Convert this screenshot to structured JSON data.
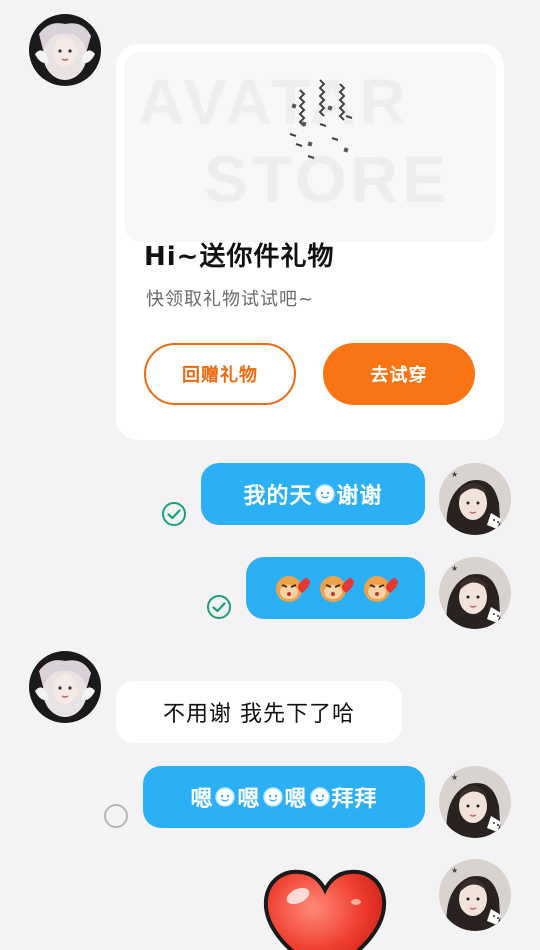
{
  "gift_card": {
    "banner_word_1": "AVATAR",
    "banner_word_2": "STORE",
    "title": "Hi~送你件礼物",
    "subtitle": "快领取礼物试试吧~",
    "return_button": "回赠礼物",
    "try_button": "去试穿"
  },
  "messages": [
    {
      "side": "out",
      "text_before": "我的天",
      "text_after": "谢谢",
      "status": "read"
    },
    {
      "side": "out",
      "type": "emoji",
      "emoji_count": 3,
      "status": "read"
    },
    {
      "side": "in",
      "text": "不用谢 我先下了哈"
    },
    {
      "side": "out",
      "parts": [
        "嗯",
        "嗯",
        "嗯",
        "拜拜"
      ],
      "status": "pending"
    },
    {
      "side": "out",
      "type": "sticker",
      "sticker": "heart"
    }
  ],
  "colors": {
    "accent_orange": "#fa7414",
    "bubble_blue": "#2cb0f5",
    "read_green": "#1aa36b",
    "background": "#f3f3f6"
  }
}
